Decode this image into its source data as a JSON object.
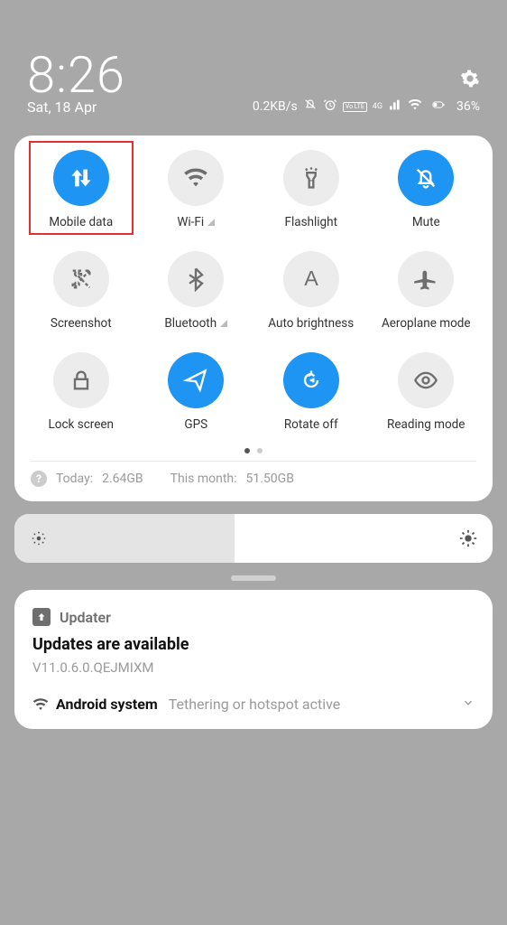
{
  "status": {
    "time": "8:26",
    "date": "Sat, 18 Apr",
    "speed": "0.2KB/s",
    "net_badge": "Vo LTE",
    "net_gen": "4G",
    "battery": "36%"
  },
  "tiles": [
    {
      "id": "mobile-data",
      "label": "Mobile data",
      "active": true,
      "icon": "arrows-ud",
      "highlight": true
    },
    {
      "id": "wifi",
      "label": "Wi-Fi",
      "active": false,
      "icon": "wifi",
      "suffix": "signal"
    },
    {
      "id": "flashlight",
      "label": "Flashlight",
      "active": false,
      "icon": "torch"
    },
    {
      "id": "mute",
      "label": "Mute",
      "active": true,
      "icon": "bell-off"
    },
    {
      "id": "screenshot",
      "label": "Screenshot",
      "active": false,
      "icon": "scissors"
    },
    {
      "id": "bluetooth",
      "label": "Bluetooth",
      "active": false,
      "icon": "bluetooth",
      "suffix": "signal"
    },
    {
      "id": "auto-bright",
      "label": "Auto brightness",
      "active": false,
      "icon": "letter-a"
    },
    {
      "id": "aeroplane",
      "label": "Aeroplane mode",
      "active": false,
      "icon": "plane"
    },
    {
      "id": "lock",
      "label": "Lock screen",
      "active": false,
      "icon": "lock"
    },
    {
      "id": "gps",
      "label": "GPS",
      "active": true,
      "icon": "nav"
    },
    {
      "id": "rotate",
      "label": "Rotate off",
      "active": true,
      "icon": "rotate-lock"
    },
    {
      "id": "reading",
      "label": "Reading mode",
      "active": false,
      "icon": "eye"
    }
  ],
  "usage": {
    "today_label": "Today:",
    "today_value": "2.64GB",
    "month_label": "This month:",
    "month_value": "51.50GB"
  },
  "brightness": {
    "percent": 46
  },
  "notifications": {
    "updater": {
      "app": "Updater",
      "title": "Updates are available",
      "version": "V11.0.6.0.QEJMIXM"
    },
    "system": {
      "app": "Android system",
      "text": "Tethering or hotspot active"
    }
  }
}
